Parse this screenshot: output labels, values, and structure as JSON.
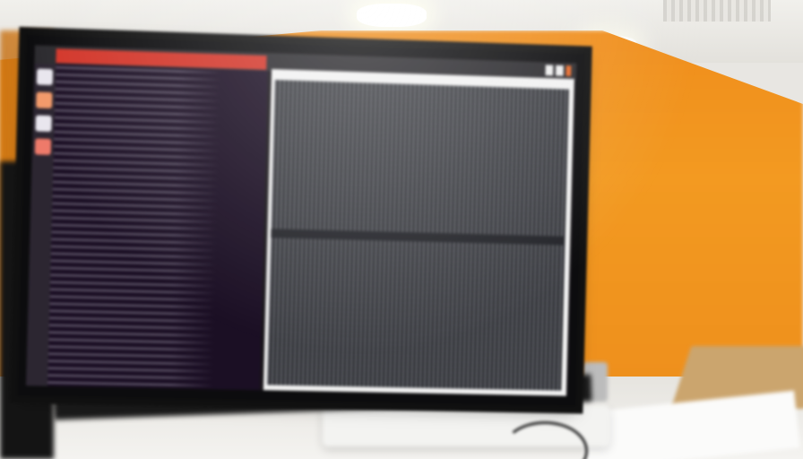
{
  "scene": {
    "subject": "computer-monitor",
    "colors": {
      "partition": "#f39a21",
      "title_bar_accent": "#d3362a",
      "terminal_background": "#1b0f24",
      "editor_background": "#2b2d31",
      "desk": "#f4f3f0"
    },
    "icons": [
      "ceiling-light-icon",
      "monitor-icon",
      "keyboard-icon",
      "terminal-icon",
      "editor-window-icon"
    ]
  }
}
